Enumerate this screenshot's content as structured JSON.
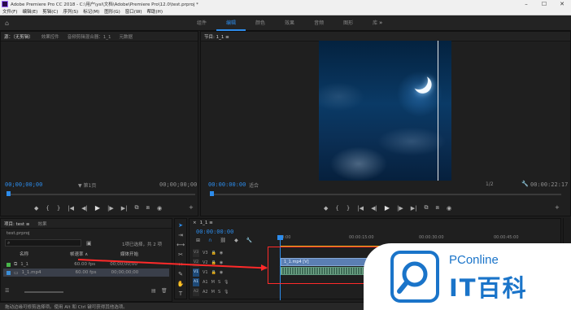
{
  "window": {
    "title": "Adobe Premiere Pro CC 2018 - C:\\用户\\ysi\\文档\\Adobe\\Premiere Pro\\12.0\\test.prproj *",
    "controls": [
      "–",
      "☐",
      "✕"
    ]
  },
  "menubar": [
    "文件(F)",
    "编辑(E)",
    "剪辑(C)",
    "序列(S)",
    "标记(M)",
    "图形(G)",
    "窗口(W)",
    "帮助(H)"
  ],
  "workspace": {
    "tabs": [
      "组件",
      "编辑",
      "颜色",
      "效果",
      "音频",
      "图形",
      "库"
    ],
    "active": "编辑",
    "more": "»"
  },
  "source_panel": {
    "tabs": [
      "源：（无剪辑）",
      "效果控件",
      "音频剪辑混合器：1_1",
      "元数据"
    ],
    "timecode_left": "00;00;00;00",
    "page_label": "▼ 第1页",
    "timecode_right": "00;00;00;00",
    "controls": [
      "◆",
      "{",
      "}",
      "|◀",
      "◀|",
      "▶",
      "|▶",
      "▶|",
      "⧉",
      "⧈",
      "◉"
    ],
    "add": "+"
  },
  "program_panel": {
    "tab": "节目: 1_1  ≡",
    "timecode_left": "00:00:00:00",
    "fit": "适合",
    "scale": "1/2",
    "timecode_right": "00:00:22:17",
    "controls": [
      "◆",
      "{",
      "}",
      "|◀",
      "◀|",
      "▶",
      "|▶",
      "▶|",
      "⧉",
      "⧈",
      "◉"
    ],
    "add": "+"
  },
  "project_panel": {
    "tabs": [
      "项目: test  ≡",
      "效果"
    ],
    "file": "test.prproj",
    "selection_info": "1项已选择，共 2 项",
    "columns": [
      "名称",
      "帧速率 ∧",
      "媒体开始"
    ],
    "items": [
      {
        "name": "1_1",
        "fps": "60.00 fps",
        "start": "00;00;00;00",
        "swatch": "#48b54a"
      },
      {
        "name": "1_1.mp4",
        "fps": "60.00 fps",
        "start": "00;00;00;00",
        "swatch": "#3b8fd8"
      }
    ]
  },
  "timeline": {
    "tab": "1_1  ≡",
    "timecode": "00:00:00:00",
    "ruler": [
      "00:00",
      "00:00:15:00",
      "00:00:30:00",
      "00:00:45:00"
    ],
    "tracks": [
      "V3",
      "V2",
      "V1",
      "A1",
      "A2",
      "A3"
    ],
    "clip_video": "1_1.mp4 [V]"
  },
  "status": "拖动边缘可修剪选择项。使用 Alt 和 Ctrl 键可获得其他选项。",
  "watermark": {
    "brand": "PConline",
    "cn": "IT百科"
  }
}
